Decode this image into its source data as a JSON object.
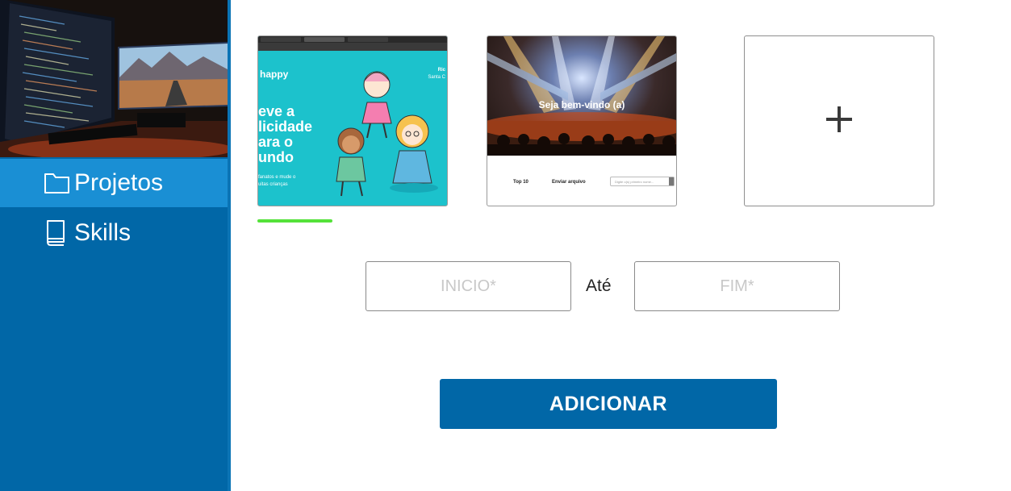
{
  "sidebar": {
    "items": [
      {
        "label": "Projetos",
        "icon": "folder-icon",
        "active": true
      },
      {
        "label": "Skills",
        "icon": "book-icon",
        "active": false
      }
    ],
    "accent": "#0167a7",
    "active_bg": "#1a8fd4"
  },
  "projects": {
    "happy": {
      "logo": "happy",
      "header_right": "Ric",
      "header_right_sub": "Santa C",
      "headline": [
        "eve a",
        "licidade",
        "ara o",
        "undo"
      ],
      "sub": [
        "fanatos e mude o",
        "uitas crianças"
      ]
    },
    "concert": {
      "title": "Seja bem-vindo (a)",
      "nav": [
        "Top 10",
        "Enviar arquivo"
      ],
      "search_placeholder": "Digite o(s) primeiro nome..."
    },
    "add_label": "+",
    "progress": 0.39,
    "progress_color": "#55e23a"
  },
  "form": {
    "start_placeholder": "INICIO*",
    "end_placeholder": "FIM*",
    "separator": "Até",
    "submit_label": "ADICIONAR"
  }
}
